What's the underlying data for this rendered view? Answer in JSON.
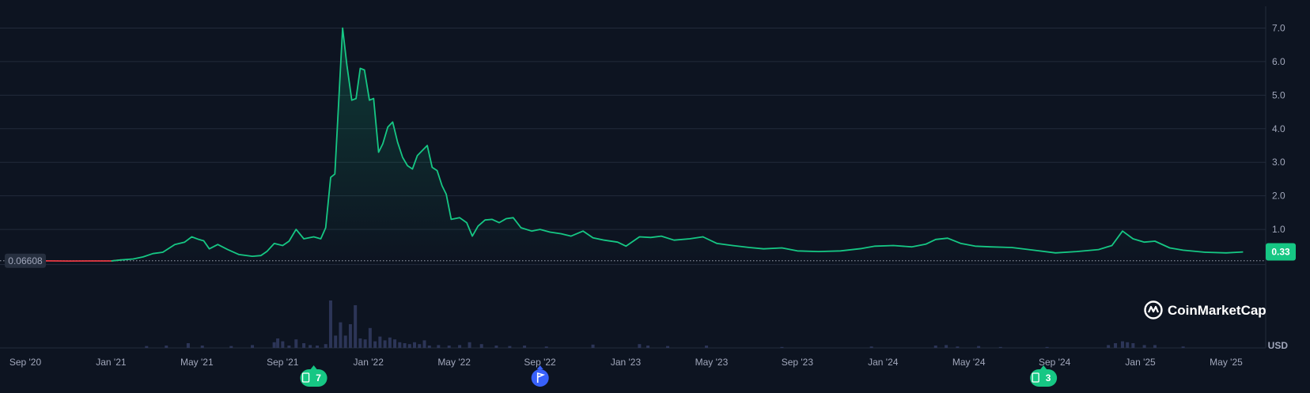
{
  "colors": {
    "background": "#0d1421",
    "grid": "#222b3b",
    "line_up": "#16c784",
    "line_start": "#ea3943",
    "volume": "#2c3557",
    "price_tag": "#16c784",
    "start_tag": "#262f3f",
    "flag_badge": "#3861fb"
  },
  "chart_data": {
    "type": "area",
    "currency": "USD",
    "y_ticks": [
      "1.0",
      "2.0",
      "3.0",
      "4.0",
      "5.0",
      "6.0",
      "7.0"
    ],
    "ylim": [
      -1.0,
      7.6
    ],
    "x_ticks": [
      "Sep '20",
      "Jan '21",
      "May '21",
      "Sep '21",
      "Jan '22",
      "May '22",
      "Sep '22",
      "Jan '23",
      "May '23",
      "Sep '23",
      "Jan '24",
      "May '24",
      "Sep '24",
      "Jan '25",
      "May '25"
    ],
    "start_price_label": "0.06608",
    "current_price_label": "0.33",
    "start_price": 0.066,
    "current_price": 0.33,
    "price_series": [
      [
        "2020-09-01",
        0.066
      ],
      [
        "2020-10-01",
        0.062
      ],
      [
        "2020-11-01",
        0.058
      ],
      [
        "2020-12-01",
        0.06
      ],
      [
        "2021-01-01",
        0.06
      ],
      [
        "2021-01-15",
        0.09
      ],
      [
        "2021-02-01",
        0.12
      ],
      [
        "2021-02-15",
        0.18
      ],
      [
        "2021-03-01",
        0.28
      ],
      [
        "2021-03-15",
        0.32
      ],
      [
        "2021-04-01",
        0.55
      ],
      [
        "2021-04-15",
        0.62
      ],
      [
        "2021-04-25",
        0.78
      ],
      [
        "2021-05-05",
        0.7
      ],
      [
        "2021-05-12",
        0.66
      ],
      [
        "2021-05-20",
        0.42
      ],
      [
        "2021-06-01",
        0.55
      ],
      [
        "2021-06-15",
        0.4
      ],
      [
        "2021-07-01",
        0.25
      ],
      [
        "2021-07-20",
        0.2
      ],
      [
        "2021-08-01",
        0.22
      ],
      [
        "2021-08-10",
        0.35
      ],
      [
        "2021-08-20",
        0.58
      ],
      [
        "2021-09-01",
        0.52
      ],
      [
        "2021-09-10",
        0.65
      ],
      [
        "2021-09-20",
        1.0
      ],
      [
        "2021-10-01",
        0.72
      ],
      [
        "2021-10-15",
        0.78
      ],
      [
        "2021-10-25",
        0.72
      ],
      [
        "2021-11-01",
        1.05
      ],
      [
        "2021-11-08",
        2.55
      ],
      [
        "2021-11-14",
        2.65
      ],
      [
        "2021-11-25",
        7.0
      ],
      [
        "2021-12-01",
        5.9
      ],
      [
        "2021-12-08",
        4.85
      ],
      [
        "2021-12-14",
        4.9
      ],
      [
        "2021-12-20",
        5.8
      ],
      [
        "2021-12-26",
        5.75
      ],
      [
        "2022-01-02",
        4.85
      ],
      [
        "2022-01-08",
        4.9
      ],
      [
        "2022-01-15",
        3.3
      ],
      [
        "2022-01-21",
        3.55
      ],
      [
        "2022-01-28",
        4.05
      ],
      [
        "2022-02-04",
        4.2
      ],
      [
        "2022-02-11",
        3.6
      ],
      [
        "2022-02-18",
        3.15
      ],
      [
        "2022-02-25",
        2.9
      ],
      [
        "2022-03-04",
        2.8
      ],
      [
        "2022-03-11",
        3.2
      ],
      [
        "2022-03-18",
        3.35
      ],
      [
        "2022-03-25",
        3.5
      ],
      [
        "2022-04-01",
        2.85
      ],
      [
        "2022-04-08",
        2.75
      ],
      [
        "2022-04-15",
        2.3
      ],
      [
        "2022-04-21",
        2.05
      ],
      [
        "2022-04-28",
        1.3
      ],
      [
        "2022-05-10",
        1.35
      ],
      [
        "2022-05-20",
        1.2
      ],
      [
        "2022-05-28",
        0.8
      ],
      [
        "2022-06-05",
        1.1
      ],
      [
        "2022-06-15",
        1.28
      ],
      [
        "2022-06-25",
        1.3
      ],
      [
        "2022-07-05",
        1.2
      ],
      [
        "2022-07-15",
        1.32
      ],
      [
        "2022-07-25",
        1.35
      ],
      [
        "2022-08-05",
        1.05
      ],
      [
        "2022-08-20",
        0.95
      ],
      [
        "2022-09-01",
        1.0
      ],
      [
        "2022-09-15",
        0.92
      ],
      [
        "2022-10-01",
        0.87
      ],
      [
        "2022-10-15",
        0.8
      ],
      [
        "2022-11-01",
        0.95
      ],
      [
        "2022-11-15",
        0.75
      ],
      [
        "2022-12-01",
        0.68
      ],
      [
        "2022-12-20",
        0.62
      ],
      [
        "2023-01-01",
        0.5
      ],
      [
        "2023-01-20",
        0.78
      ],
      [
        "2023-02-05",
        0.76
      ],
      [
        "2023-02-20",
        0.8
      ],
      [
        "2023-03-10",
        0.68
      ],
      [
        "2023-04-01",
        0.72
      ],
      [
        "2023-04-20",
        0.78
      ],
      [
        "2023-05-10",
        0.58
      ],
      [
        "2023-06-01",
        0.52
      ],
      [
        "2023-06-25",
        0.46
      ],
      [
        "2023-07-15",
        0.42
      ],
      [
        "2023-08-10",
        0.45
      ],
      [
        "2023-09-01",
        0.36
      ],
      [
        "2023-10-01",
        0.34
      ],
      [
        "2023-11-01",
        0.36
      ],
      [
        "2023-12-01",
        0.43
      ],
      [
        "2023-12-20",
        0.5
      ],
      [
        "2024-01-15",
        0.52
      ],
      [
        "2024-02-10",
        0.48
      ],
      [
        "2024-03-01",
        0.56
      ],
      [
        "2024-03-15",
        0.7
      ],
      [
        "2024-04-01",
        0.74
      ],
      [
        "2024-04-20",
        0.58
      ],
      [
        "2024-05-10",
        0.5
      ],
      [
        "2024-06-01",
        0.48
      ],
      [
        "2024-07-01",
        0.46
      ],
      [
        "2024-08-01",
        0.38
      ],
      [
        "2024-09-01",
        0.3
      ],
      [
        "2024-10-01",
        0.34
      ],
      [
        "2024-11-01",
        0.4
      ],
      [
        "2024-11-20",
        0.52
      ],
      [
        "2024-12-05",
        0.95
      ],
      [
        "2024-12-20",
        0.72
      ],
      [
        "2025-01-05",
        0.62
      ],
      [
        "2025-01-20",
        0.65
      ],
      [
        "2025-02-10",
        0.45
      ],
      [
        "2025-03-01",
        0.38
      ],
      [
        "2025-04-01",
        0.32
      ],
      [
        "2025-05-01",
        0.3
      ],
      [
        "2025-05-25",
        0.33
      ]
    ],
    "volume_series": [
      [
        "2021-02-20",
        0.04
      ],
      [
        "2021-03-20",
        0.05
      ],
      [
        "2021-04-20",
        0.1
      ],
      [
        "2021-05-10",
        0.05
      ],
      [
        "2021-06-20",
        0.04
      ],
      [
        "2021-07-20",
        0.06
      ],
      [
        "2021-08-20",
        0.12
      ],
      [
        "2021-08-25",
        0.2
      ],
      [
        "2021-09-01",
        0.14
      ],
      [
        "2021-09-10",
        0.05
      ],
      [
        "2021-09-20",
        0.18
      ],
      [
        "2021-10-01",
        0.1
      ],
      [
        "2021-10-10",
        0.06
      ],
      [
        "2021-10-20",
        0.05
      ],
      [
        "2021-11-01",
        0.08
      ],
      [
        "2021-11-08",
        1.0
      ],
      [
        "2021-11-15",
        0.26
      ],
      [
        "2021-11-22",
        0.54
      ],
      [
        "2021-11-29",
        0.26
      ],
      [
        "2021-12-06",
        0.5
      ],
      [
        "2021-12-13",
        0.9
      ],
      [
        "2021-12-20",
        0.2
      ],
      [
        "2021-12-27",
        0.18
      ],
      [
        "2022-01-03",
        0.42
      ],
      [
        "2022-01-10",
        0.14
      ],
      [
        "2022-01-17",
        0.24
      ],
      [
        "2022-01-24",
        0.16
      ],
      [
        "2022-01-31",
        0.22
      ],
      [
        "2022-02-07",
        0.18
      ],
      [
        "2022-02-14",
        0.12
      ],
      [
        "2022-02-21",
        0.1
      ],
      [
        "2022-02-28",
        0.08
      ],
      [
        "2022-03-07",
        0.12
      ],
      [
        "2022-03-14",
        0.08
      ],
      [
        "2022-03-21",
        0.16
      ],
      [
        "2022-03-28",
        0.05
      ],
      [
        "2022-04-10",
        0.06
      ],
      [
        "2022-04-25",
        0.05
      ],
      [
        "2022-05-10",
        0.06
      ],
      [
        "2022-05-24",
        0.12
      ],
      [
        "2022-06-10",
        0.08
      ],
      [
        "2022-07-01",
        0.05
      ],
      [
        "2022-07-20",
        0.04
      ],
      [
        "2022-08-10",
        0.05
      ],
      [
        "2022-09-10",
        0.03
      ],
      [
        "2022-11-15",
        0.07
      ],
      [
        "2023-01-20",
        0.08
      ],
      [
        "2023-02-01",
        0.05
      ],
      [
        "2023-03-01",
        0.04
      ],
      [
        "2023-04-25",
        0.05
      ],
      [
        "2023-08-10",
        0.02
      ],
      [
        "2023-12-15",
        0.03
      ],
      [
        "2024-03-15",
        0.05
      ],
      [
        "2024-03-30",
        0.06
      ],
      [
        "2024-04-15",
        0.03
      ],
      [
        "2024-05-15",
        0.04
      ],
      [
        "2024-06-15",
        0.02
      ],
      [
        "2024-08-20",
        0.02
      ],
      [
        "2024-11-15",
        0.06
      ],
      [
        "2024-11-25",
        0.1
      ],
      [
        "2024-12-05",
        0.14
      ],
      [
        "2024-12-12",
        0.12
      ],
      [
        "2024-12-20",
        0.1
      ],
      [
        "2025-01-05",
        0.06
      ],
      [
        "2025-01-20",
        0.06
      ],
      [
        "2025-03-01",
        0.03
      ]
    ]
  },
  "events": [
    {
      "date": "2021-10-15",
      "kind": "news",
      "label": "7"
    },
    {
      "date": "2022-09-01",
      "kind": "flag",
      "label": ""
    },
    {
      "date": "2024-08-15",
      "kind": "news",
      "label": "3"
    }
  ],
  "watermark": {
    "text": "CoinMarketCap"
  }
}
